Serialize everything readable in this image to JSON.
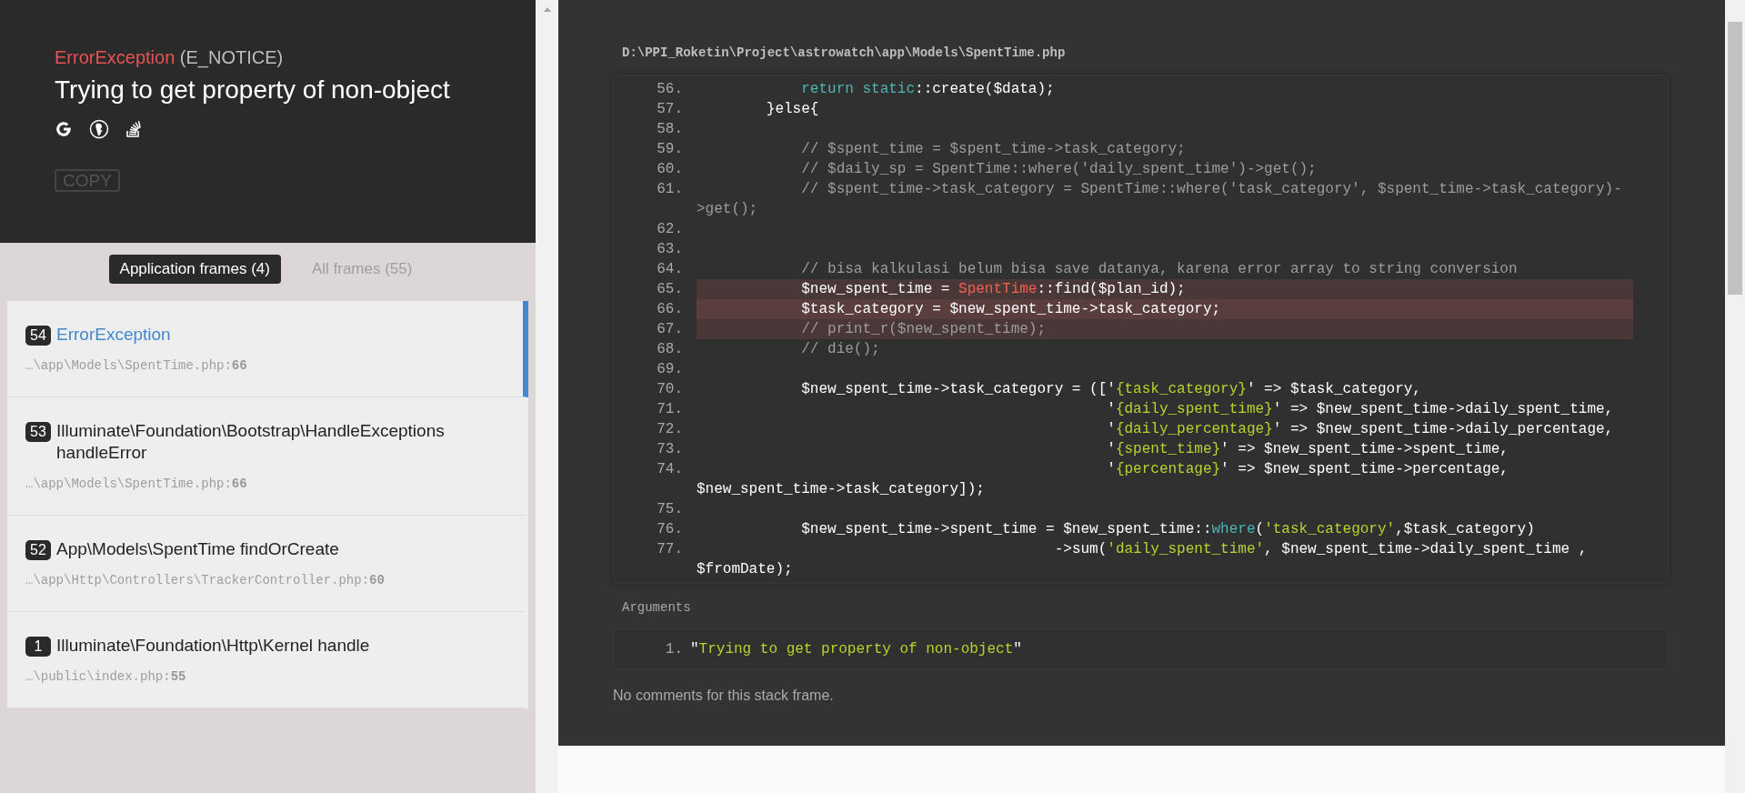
{
  "exception": {
    "type": "ErrorException",
    "code": "(E_NOTICE)",
    "message": "Trying to get property of non-object",
    "copy_button": "COPY"
  },
  "frame_tabs": [
    {
      "label": "Application frames (4)",
      "selected": true
    },
    {
      "label": "All frames (55)",
      "selected": false
    }
  ],
  "frames": [
    {
      "number": "54",
      "name": "ErrorException",
      "location": "…\\app\\Models\\SpentTime.php:**66**",
      "selected": true
    },
    {
      "number": "53",
      "name": "Illuminate\\Foundation\\Bootstrap\\HandleExceptions handleError",
      "location": "…\\app\\Models\\SpentTime.php:**66**",
      "selected": false
    },
    {
      "number": "52",
      "name": "App\\Models\\SpentTime findOrCreate",
      "location": "…\\app\\Http\\Controllers\\TrackerController.php:**60**",
      "selected": false
    },
    {
      "number": "1",
      "name": "Illuminate\\Foundation\\Http\\Kernel handle",
      "location": "…\\public\\index.php:**55**",
      "selected": false
    }
  ],
  "code_view": {
    "file_path": "D:\\PPI_Roketin\\Project\\astrowatch\\app\\Models\\SpentTime.php",
    "lines": [
      {
        "number": "56.",
        "highlighted": false,
        "current": false,
        "segments": [
          {
            "kind": "keyword",
            "text": "            return"
          },
          {
            "kind": "keyword",
            "text": " static"
          },
          {
            "kind": "plain",
            "text": "::create($data);"
          }
        ]
      },
      {
        "number": "57.",
        "highlighted": false,
        "current": false,
        "segments": [
          {
            "kind": "plain",
            "text": "        }else{"
          }
        ]
      },
      {
        "number": "58."
      },
      {
        "number": "59.",
        "highlighted": false,
        "current": false,
        "segments": [
          {
            "kind": "comment",
            "text": "            // $spent_time = $spent_time->task_category;"
          }
        ]
      },
      {
        "number": "60.",
        "highlighted": false,
        "current": false,
        "segments": [
          {
            "kind": "comment",
            "text": "            // $daily_sp = SpentTime::where('daily_spent_time')->get();"
          }
        ]
      },
      {
        "number": "61.",
        "highlighted": false,
        "current": false,
        "segments": [
          {
            "kind": "comment",
            "text": "            // $spent_time->task_category = SpentTime::where('task_category', $spent_time->task_category)->get();"
          }
        ]
      },
      {
        "number": "62."
      },
      {
        "number": "63."
      },
      {
        "number": "64.",
        "highlighted": false,
        "current": false,
        "segments": [
          {
            "kind": "comment",
            "text": "            // bisa kalkulasi belum bisa save datanya, karena error array to string conversion"
          }
        ]
      },
      {
        "number": "65.",
        "highlighted": true,
        "current": false,
        "segments": [
          {
            "kind": "plain",
            "text": "            $new_spent_time = "
          },
          {
            "kind": "class",
            "text": "SpentTime"
          },
          {
            "kind": "plain",
            "text": "::find($plan_id);"
          }
        ]
      },
      {
        "number": "66.",
        "highlighted": true,
        "current": true,
        "segments": [
          {
            "kind": "plain",
            "text": "            $task_category = $new_spent_time->task_category;"
          }
        ]
      },
      {
        "number": "67.",
        "highlighted": true,
        "current": false,
        "segments": [
          {
            "kind": "comment",
            "text": "            // print_r($new_spent_time);"
          }
        ]
      },
      {
        "number": "68.",
        "highlighted": false,
        "current": false,
        "segments": [
          {
            "kind": "comment",
            "text": "            // die();"
          }
        ]
      },
      {
        "number": "69."
      },
      {
        "number": "70.",
        "highlighted": false,
        "current": false,
        "segments": [
          {
            "kind": "plain",
            "text": "            $new_spent_time->task_category = (['"
          },
          {
            "kind": "string",
            "text": "{task_category}"
          },
          {
            "kind": "plain",
            "text": "' => $task_category,"
          }
        ]
      },
      {
        "number": "71.",
        "highlighted": false,
        "current": false,
        "segments": [
          {
            "kind": "plain",
            "text": "                                               '"
          },
          {
            "kind": "string",
            "text": "{daily_spent_time}"
          },
          {
            "kind": "plain",
            "text": "' => $new_spent_time->daily_spent_time,"
          }
        ]
      },
      {
        "number": "72.",
        "highlighted": false,
        "current": false,
        "segments": [
          {
            "kind": "plain",
            "text": "                                               '"
          },
          {
            "kind": "string",
            "text": "{daily_percentage}"
          },
          {
            "kind": "plain",
            "text": "' => $new_spent_time->daily_percentage,"
          }
        ]
      },
      {
        "number": "73.",
        "highlighted": false,
        "current": false,
        "segments": [
          {
            "kind": "plain",
            "text": "                                               '"
          },
          {
            "kind": "string",
            "text": "{spent_time}"
          },
          {
            "kind": "plain",
            "text": "' => $new_spent_time->spent_time,"
          }
        ]
      },
      {
        "number": "74.",
        "highlighted": false,
        "current": false,
        "segments": [
          {
            "kind": "plain",
            "text": "                                               '"
          },
          {
            "kind": "string",
            "text": "{percentage}"
          },
          {
            "kind": "plain",
            "text": "' => $new_spent_time->percentage, $new_spent_time->task_category]);"
          }
        ]
      },
      {
        "number": "75."
      },
      {
        "number": "76.",
        "highlighted": false,
        "current": false,
        "segments": [
          {
            "kind": "plain",
            "text": "            $new_spent_time->spent_time = $new_spent_time::"
          },
          {
            "kind": "keyword",
            "text": "where"
          },
          {
            "kind": "plain",
            "text": "("
          },
          {
            "kind": "string",
            "text": "'task_category'"
          },
          {
            "kind": "plain",
            "text": ",$task_category)"
          }
        ]
      },
      {
        "number": "77.",
        "highlighted": false,
        "current": false,
        "segments": [
          {
            "kind": "plain",
            "text": "                                         ->sum("
          },
          {
            "kind": "string",
            "text": "'daily_spent_time'"
          },
          {
            "kind": "plain",
            "text": ", $new_spent_time->daily_spent_time , $fromDate);"
          }
        ]
      }
    ]
  },
  "arguments": {
    "label": "Arguments",
    "items": [
      {
        "number": "1.",
        "value": "\"Trying to get property of non-object\""
      }
    ]
  },
  "comments_note": "No comments for this stack frame."
}
